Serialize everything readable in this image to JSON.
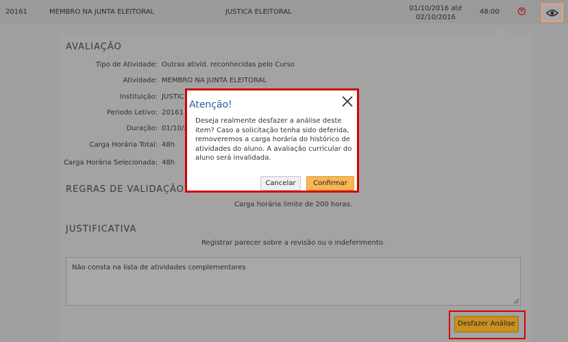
{
  "row": {
    "code": "20161",
    "activity": "MEMBRO NA JUNTA ELEITORAL",
    "institution": "JUSTICA ELEITORAL",
    "period_line1": "01/10/2016 até",
    "period_line2": "02/10/2016",
    "hours": "48:00"
  },
  "avaliacao": {
    "title": "AVALIAÇÃO",
    "fields": [
      {
        "label": "Tipo de Atividade:",
        "value": "Outras ativid. reconhecidas pelo Curso"
      },
      {
        "label": "Atividade:",
        "value": "MEMBRO NA JUNTA ELEITORAL"
      },
      {
        "label": "Instituição:",
        "value": "JUSTIC"
      },
      {
        "label": "Periodo Letivo:",
        "value": "20161"
      },
      {
        "label": "Duração:",
        "value": "01/10/2"
      },
      {
        "label": "Carga Horária Total:",
        "value": "48h"
      },
      {
        "label": "Carga Horária Selecionada:",
        "value": "48h"
      }
    ]
  },
  "regras": {
    "title": "REGRAS DE VALIDAÇÃO",
    "text": "Carga horária limite de 200 horas."
  },
  "justificativa": {
    "title": "JUSTIFICATIVA",
    "hint": "Registrar parecer sobre a revisão ou o indeferimento.",
    "text": "Não consta na lista de atividades complementares"
  },
  "undo_button": "Desfazer Análise",
  "modal": {
    "title": "Atenção!",
    "body": "Deseja realmente desfazer a análise deste item? Caso a solicitação tenha sido deferida, removeremos a carga horária do histórico de atividades do aluno. A avaliação curricular do aluno será invalidada.",
    "cancel": "Cancelar",
    "confirm": "Confirmar"
  },
  "colors": {
    "modal_title": "#2a5c9e",
    "confirm_button": "#f9b655",
    "highlight_border": "#d40000",
    "remove_icon": "#b00000"
  }
}
